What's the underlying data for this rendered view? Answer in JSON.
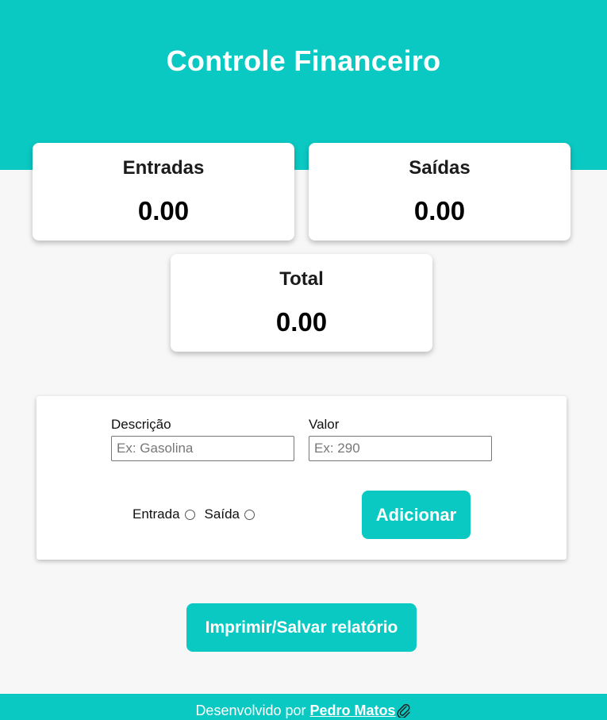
{
  "header": {
    "title": "Controle Financeiro"
  },
  "summary": {
    "income": {
      "label": "Entradas",
      "value": "0.00"
    },
    "expense": {
      "label": "Saídas",
      "value": "0.00"
    },
    "total": {
      "label": "Total",
      "value": "0.00"
    }
  },
  "form": {
    "description": {
      "label": "Descrição",
      "placeholder": "Ex: Gasolina",
      "value": ""
    },
    "amount": {
      "label": "Valor",
      "placeholder": "Ex: 290",
      "value": ""
    },
    "type_options": [
      "Entrada",
      "Saída"
    ],
    "add_label": "Adicionar"
  },
  "actions": {
    "print_label": "Imprimir/Salvar relatório"
  },
  "footer": {
    "prefix": "Desenvolvido por",
    "author": "Pedro Matos",
    "icon": "paperclip-icon"
  },
  "colors": {
    "accent": "#0ac9c2",
    "background": "#f7f7f7"
  }
}
